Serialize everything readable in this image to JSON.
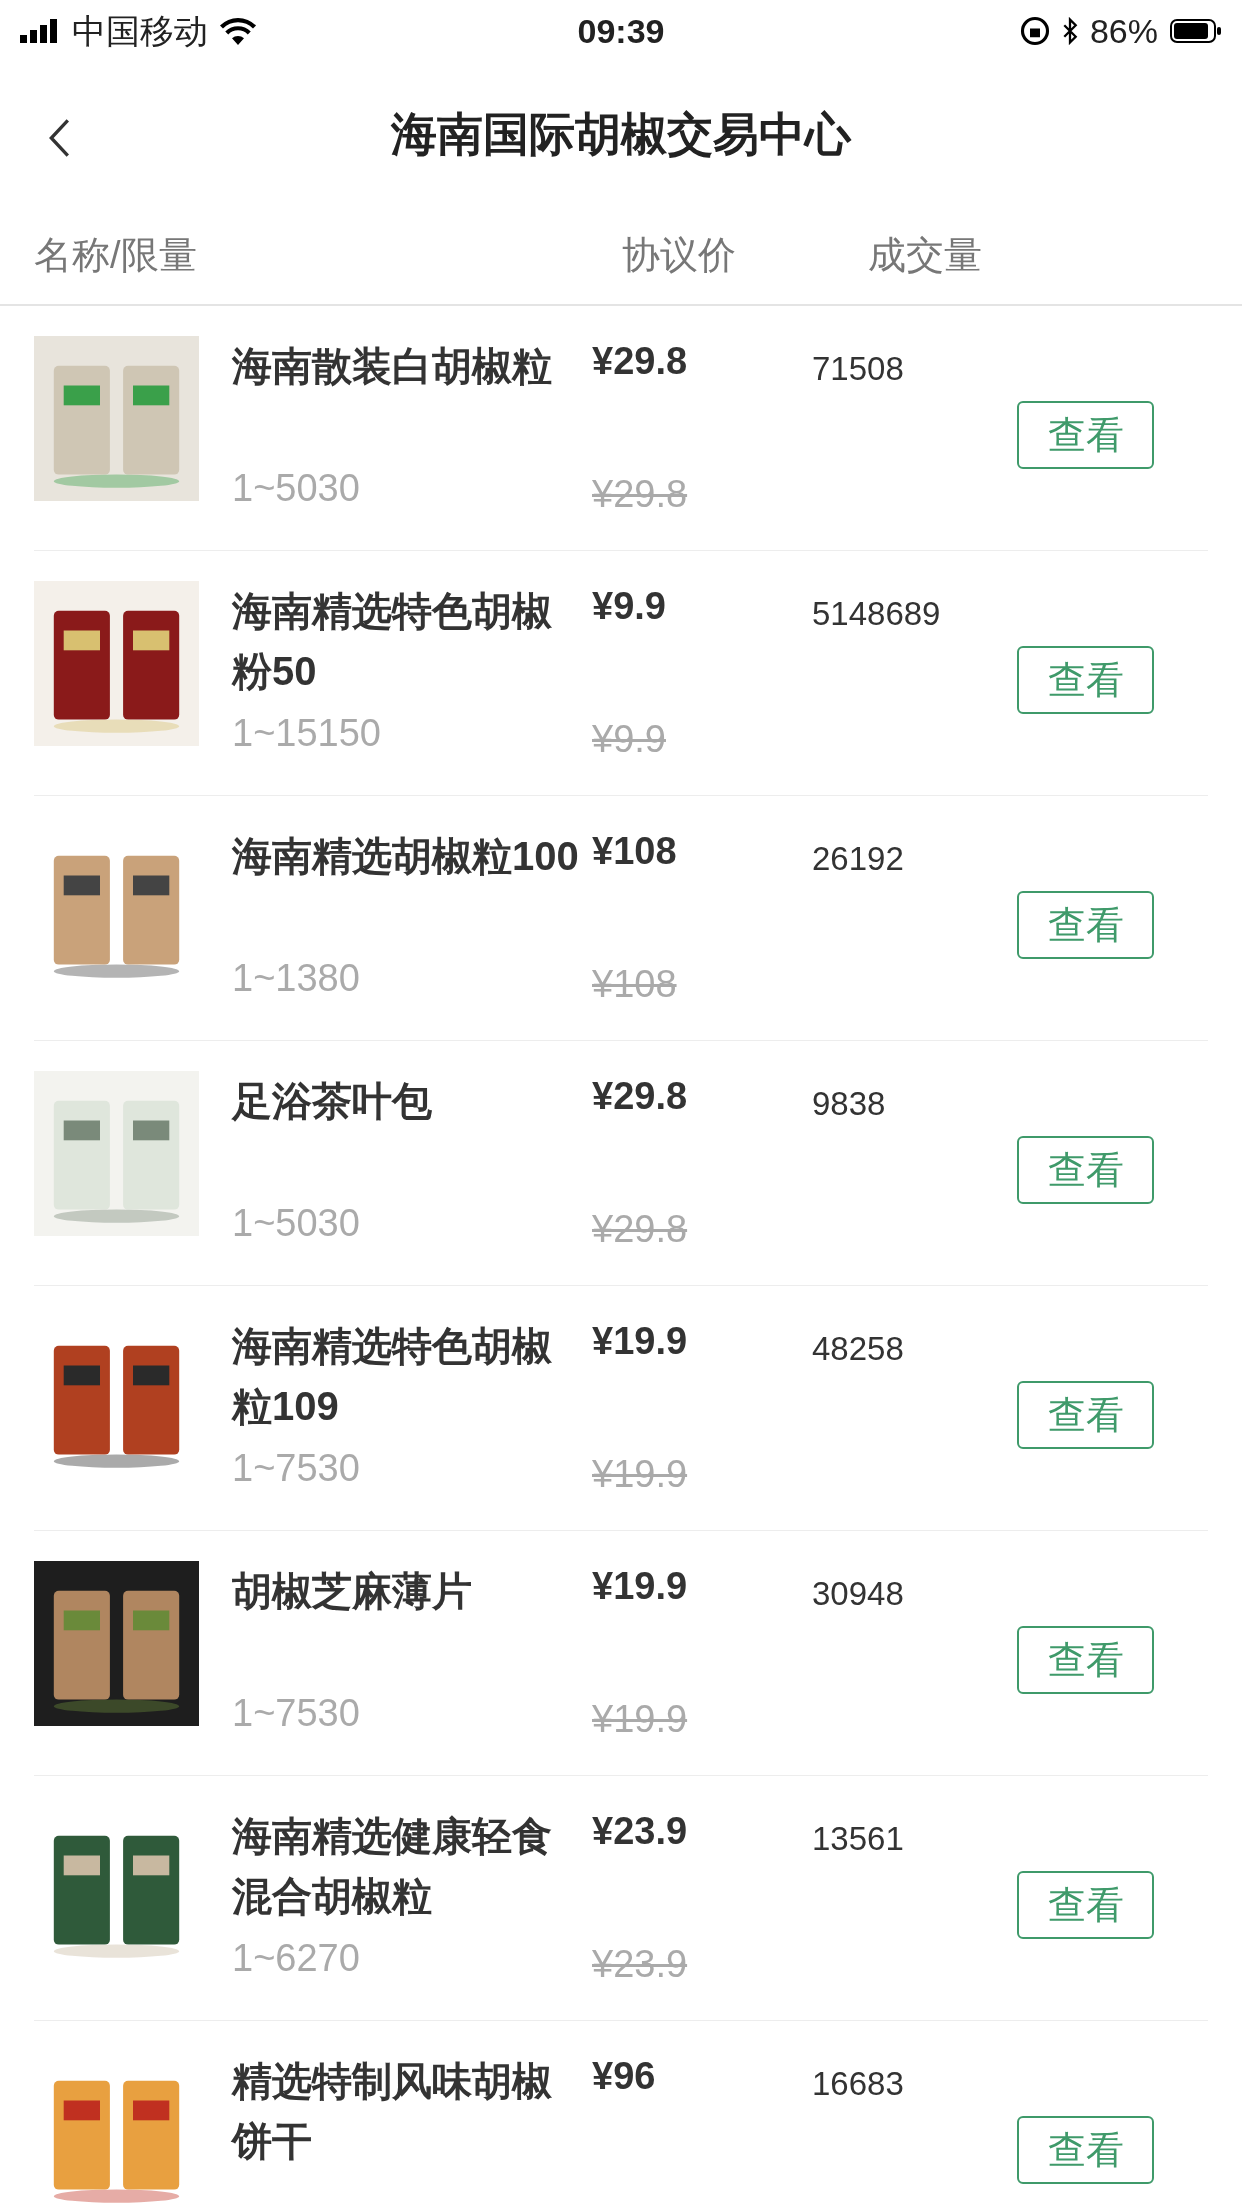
{
  "status_bar": {
    "carrier": "中国移动",
    "time": "09:39",
    "battery": "86%"
  },
  "nav": {
    "title": "海南国际胡椒交易中心"
  },
  "columns": [
    "名称/限量",
    "协议价",
    "成交量"
  ],
  "rows": [
    {
      "name": "海南散装白胡椒粒",
      "range": "1~5030",
      "price": "¥29.8",
      "old_price": "¥29.8",
      "volume": "71508",
      "button": "查看"
    },
    {
      "name": "海南精选特色胡椒粉50",
      "range": "1~15150",
      "price": "¥9.9",
      "old_price": "¥9.9",
      "volume": "5148689",
      "button": "查看"
    },
    {
      "name": "海南精选胡椒粒100",
      "range": "1~1380",
      "price": "¥108",
      "old_price": "¥108",
      "volume": "26192",
      "button": "查看"
    },
    {
      "name": "足浴茶叶包",
      "range": "1~5030",
      "price": "¥29.8",
      "old_price": "¥29.8",
      "volume": "9838",
      "button": "查看"
    },
    {
      "name": "海南精选特色胡椒粒109",
      "range": "1~7530",
      "price": "¥19.9",
      "old_price": "¥19.9",
      "volume": "48258",
      "button": "查看"
    },
    {
      "name": "胡椒芝麻薄片",
      "range": "1~7530",
      "price": "¥19.9",
      "old_price": "¥19.9",
      "volume": "30948",
      "button": "查看"
    },
    {
      "name": "海南精选健康轻食混合胡椒粒",
      "range": "1~6270",
      "price": "¥23.9",
      "old_price": "¥23.9",
      "volume": "13561",
      "button": "查看"
    },
    {
      "name": "精选特制风味胡椒饼干",
      "price": "¥96",
      "volume": "16683",
      "button": "查看"
    }
  ]
}
